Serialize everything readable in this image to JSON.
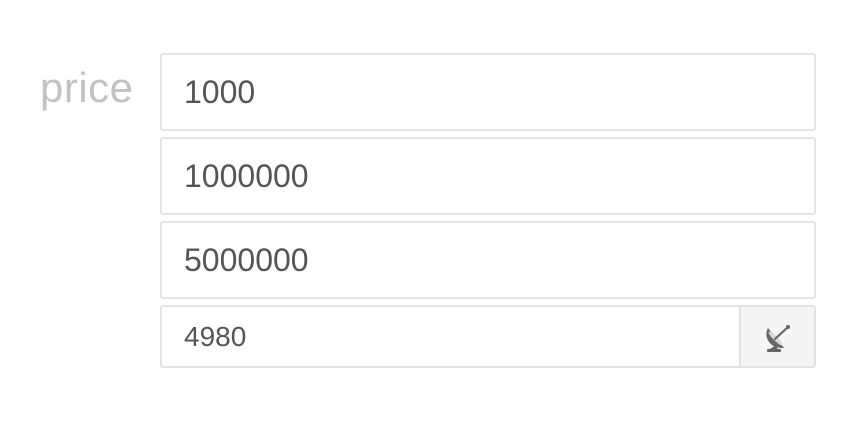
{
  "form": {
    "label": "price",
    "inputs": [
      {
        "value": "1000"
      },
      {
        "value": "1000000"
      },
      {
        "value": "5000000"
      }
    ],
    "small_input": {
      "value": "4980"
    },
    "addon": {
      "icon": "satellite-dish-icon"
    }
  }
}
